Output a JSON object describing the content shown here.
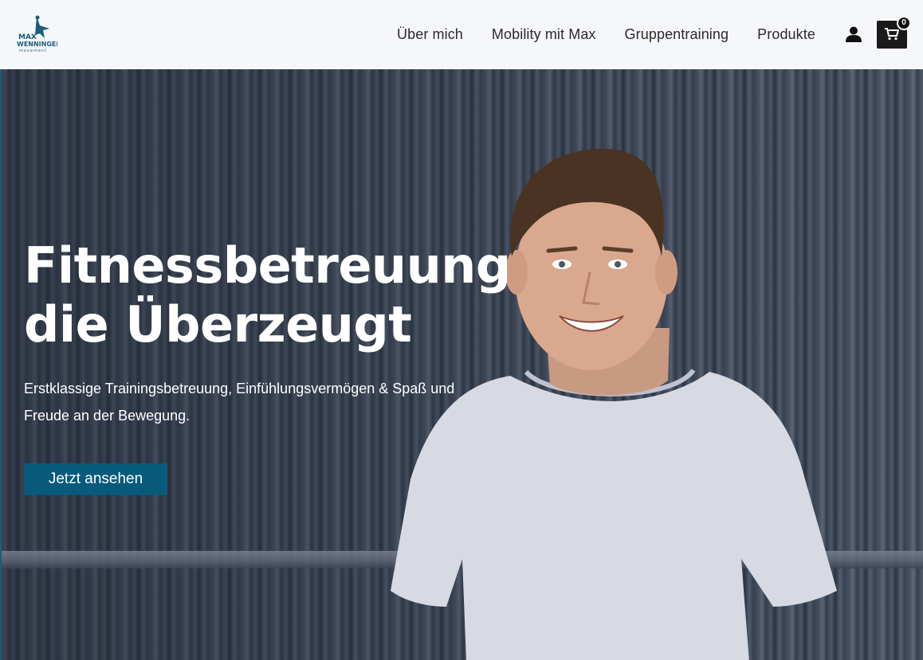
{
  "brand": {
    "logo_line1": "MAX",
    "logo_line2": "WENNINGER",
    "logo_line3": "movement",
    "color": "#1c5c7c"
  },
  "nav": {
    "items": [
      {
        "label": "Über mich"
      },
      {
        "label": "Mobility mit Max"
      },
      {
        "label": "Gruppentraining"
      },
      {
        "label": "Produkte"
      }
    ],
    "account_icon": "user-icon",
    "cart_icon": "cart-icon",
    "cart_count": "0"
  },
  "hero": {
    "title": "Fitnessbetreuung die Überzeugt",
    "subtitle": "Erstklassige Trainingsbetreuung, Einfühlungsvermögen & Spaß und Freude an der Bewegung.",
    "cta_label": "Jetzt ansehen",
    "cta_color": "#075a7a"
  }
}
